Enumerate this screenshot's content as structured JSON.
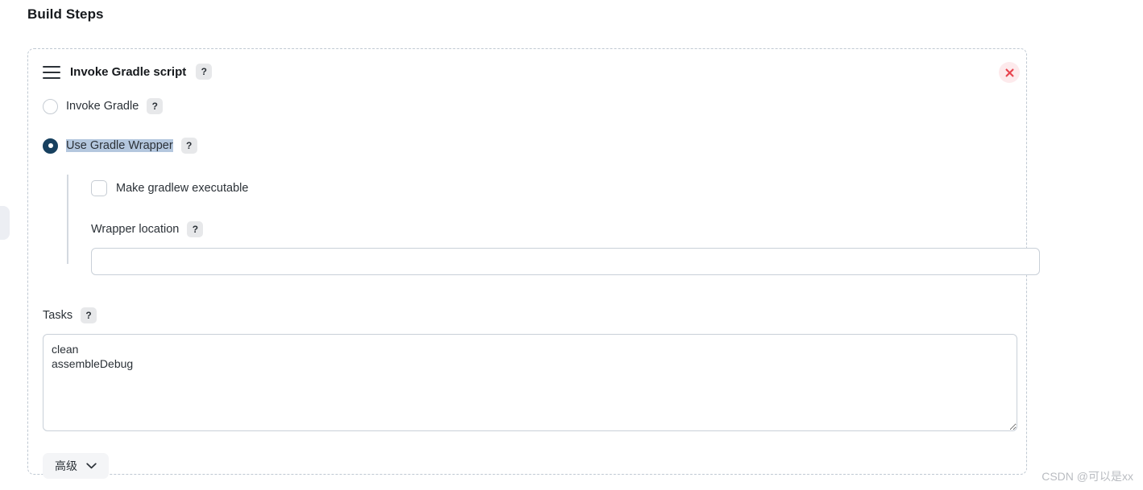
{
  "page": {
    "title": "Build Steps"
  },
  "step": {
    "title": "Invoke Gradle script",
    "drag_handle_icon": "hamburger-drag-icon",
    "help_icon": "question-mark-icon",
    "help_label": "?",
    "close_icon": "close-x-icon"
  },
  "options": [
    {
      "label": "Invoke Gradle",
      "selected": false,
      "help_label": "?",
      "text_selected": false
    },
    {
      "label": "Use Gradle Wrapper",
      "selected": true,
      "help_label": "?",
      "text_selected": true
    }
  ],
  "wrapper": {
    "make_executable_label": "Make gradlew executable",
    "make_executable_checked": false,
    "location_label": "Wrapper location",
    "location_help_label": "?",
    "location_value": "",
    "location_placeholder": ""
  },
  "tasks": {
    "label": "Tasks",
    "help_label": "?",
    "value": "clean\nassembleDebug",
    "placeholder": ""
  },
  "advanced": {
    "label": "高级",
    "chevron_icon": "chevron-down-icon"
  },
  "watermark": {
    "text": "CSDN @可以是xx"
  },
  "colors": {
    "accent": "#17405f",
    "selection": "#b4c7de",
    "close_bg": "#fdeaec",
    "close_fg": "#e8454f",
    "dashed_border": "#bfc8d2",
    "badge_bg": "#e7e8ea",
    "advanced_bg": "#f4f5f7"
  }
}
